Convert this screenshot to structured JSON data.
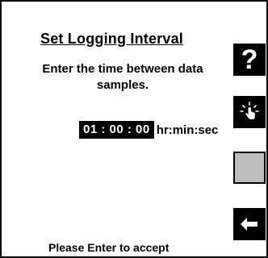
{
  "dialog": {
    "title": "Set Logging Interval",
    "instructions": "Enter the time between data samples.",
    "time_value": "01 : 00 : 00",
    "time_unit": "hr:min:sec",
    "footer": "Please Enter to accept"
  },
  "side_buttons": {
    "help_label": "?",
    "icons": [
      "help-icon",
      "touch-icon",
      "blank-button",
      "back-arrow-icon"
    ]
  },
  "colors": {
    "background": "#ffffff",
    "foreground": "#000000",
    "blank_button": "#bdbdbd"
  }
}
